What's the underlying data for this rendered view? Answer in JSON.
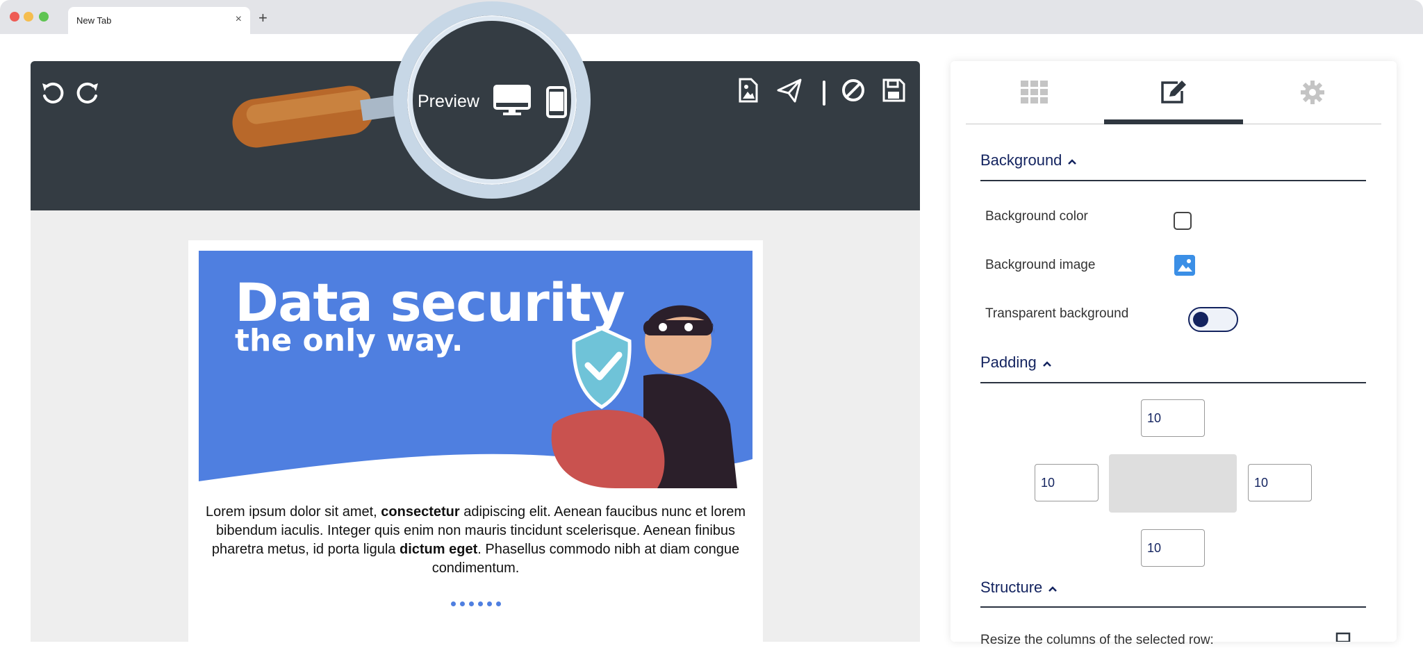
{
  "browser": {
    "tab_title": "New Tab",
    "tab_close": "×",
    "new_tab": "+"
  },
  "toolbar": {
    "preview_label": "Preview",
    "icons": [
      "undo-icon",
      "redo-icon",
      "desktop-icon",
      "mobile-icon",
      "image-file-icon",
      "send-icon",
      "block-icon",
      "save-icon"
    ]
  },
  "email": {
    "banner_title": "Data security",
    "banner_subtitle": "the only way.",
    "body_parts": [
      "Lorem ipsum dolor sit amet, ",
      "consectetur",
      " adipiscing elit. Aenean faucibus nunc et lorem bibendum iaculis. Integer quis enim non mauris tincidunt scelerisque. Aenean finibus pharetra metus, id porta ligula ",
      "dictum eget",
      ". Phasellus commodo nibh at diam congue condimentum."
    ],
    "dots_count": 6
  },
  "panel": {
    "tabs": [
      {
        "icon": "grid-icon",
        "active": false
      },
      {
        "icon": "edit-icon",
        "active": true
      },
      {
        "icon": "gear-icon",
        "active": false
      }
    ],
    "background": {
      "title": "Background",
      "color_label": "Background color",
      "image_label": "Background image",
      "transparent_label": "Transparent background",
      "transparent_on": true
    },
    "padding": {
      "title": "Padding",
      "top": "10",
      "left": "10",
      "right": "10",
      "bottom": "10"
    },
    "structure": {
      "title": "Structure",
      "text": "Resize the columns of the selected row:"
    }
  },
  "colors": {
    "toolbar_bg": "#343c43",
    "banner_bg": "#4f7fe0",
    "accent_navy": "#13235f"
  }
}
